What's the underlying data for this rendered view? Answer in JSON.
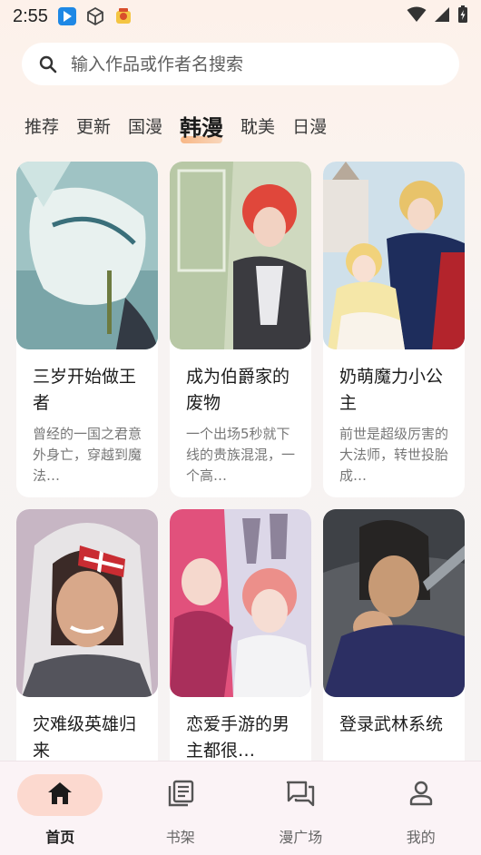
{
  "status_bar": {
    "time": "2:55",
    "icons": [
      "app-shortcut-icon",
      "cube-icon",
      "game-icon",
      "wifi-icon",
      "signal-icon",
      "battery-charging-icon"
    ]
  },
  "search": {
    "placeholder": "输入作品或作者名搜索"
  },
  "tabs": [
    {
      "label": "推荐"
    },
    {
      "label": "更新"
    },
    {
      "label": "国漫"
    },
    {
      "label": "韩漫",
      "active": true
    },
    {
      "label": "耽美"
    },
    {
      "label": "日漫"
    }
  ],
  "comics": [
    {
      "title": "三岁开始做王者",
      "desc": "曾经的一国之君意外身亡，穿越到魔法…"
    },
    {
      "title": "成为伯爵家的废物",
      "desc": "一个出场5秒就下线的贵族混混，一个高…"
    },
    {
      "title": "奶萌魔力小公主",
      "desc": "前世是超级厉害的大法师，转世投胎成…"
    },
    {
      "title": "灾难级英雄归来",
      "desc": ""
    },
    {
      "title": "恋爱手游的男主都很…",
      "desc": ""
    },
    {
      "title": "登录武林系统",
      "desc": ""
    }
  ],
  "bottom_nav": [
    {
      "label": "首页",
      "icon": "home-icon",
      "active": true
    },
    {
      "label": "书架",
      "icon": "bookshelf-icon"
    },
    {
      "label": "漫广场",
      "icon": "forum-icon"
    },
    {
      "label": "我的",
      "icon": "profile-icon"
    }
  ],
  "colors": {
    "accent": "#f7a36e",
    "nav_active_bg": "#fcd9cf",
    "page_bg": "#f6f3f3"
  }
}
